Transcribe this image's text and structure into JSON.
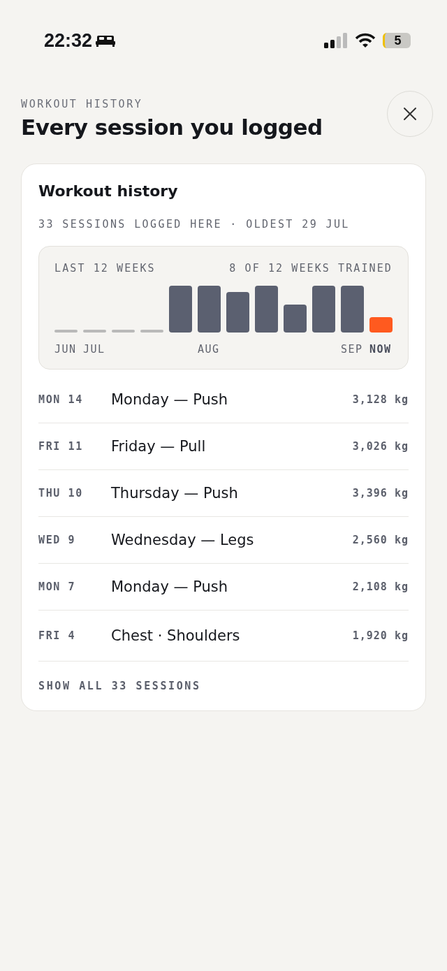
{
  "status_bar": {
    "time": "22:32",
    "battery": "5"
  },
  "header": {
    "eyebrow": "WORKOUT HISTORY",
    "title": "Every session you logged"
  },
  "card": {
    "title": "Workout history",
    "subtitle": "33 SESSIONS LOGGED HERE · OLDEST 29 JUL",
    "chart": {
      "caption": "LAST 12 WEEKS",
      "summary": "8 OF 12 WEEKS TRAINED",
      "weeks": [
        {
          "kind": "rest",
          "label": "JUN"
        },
        {
          "kind": "rest",
          "label": "JUL"
        },
        {
          "kind": "rest"
        },
        {
          "kind": "rest"
        },
        {
          "kind": "trained"
        },
        {
          "kind": "trained",
          "label": "AUG"
        },
        {
          "kind": "trained"
        },
        {
          "kind": "trained"
        },
        {
          "kind": "trained"
        },
        {
          "kind": "trained"
        },
        {
          "kind": "trained",
          "label": "SEP"
        },
        {
          "kind": "current",
          "label": "NOW"
        }
      ]
    },
    "sessions": [
      {
        "day": "MON 14",
        "name": "Monday — Push",
        "volume": "3,128 kg"
      },
      {
        "day": "FRI 11",
        "name": "Friday — Pull",
        "volume": "3,026 kg"
      },
      {
        "day": "THU 10",
        "name": "Thursday — Push",
        "volume": "3,396 kg"
      },
      {
        "day": "WED 9",
        "name": "Wednesday — Legs",
        "volume": "2,560 kg"
      },
      {
        "day": "MON 7",
        "name": "Monday — Push",
        "volume": "2,108 kg"
      },
      {
        "day": "FRI 4",
        "name": "Chest · Shoulders",
        "volume": "1,920 kg"
      }
    ],
    "show_all": "SHOW ALL 33 SESSIONS"
  }
}
